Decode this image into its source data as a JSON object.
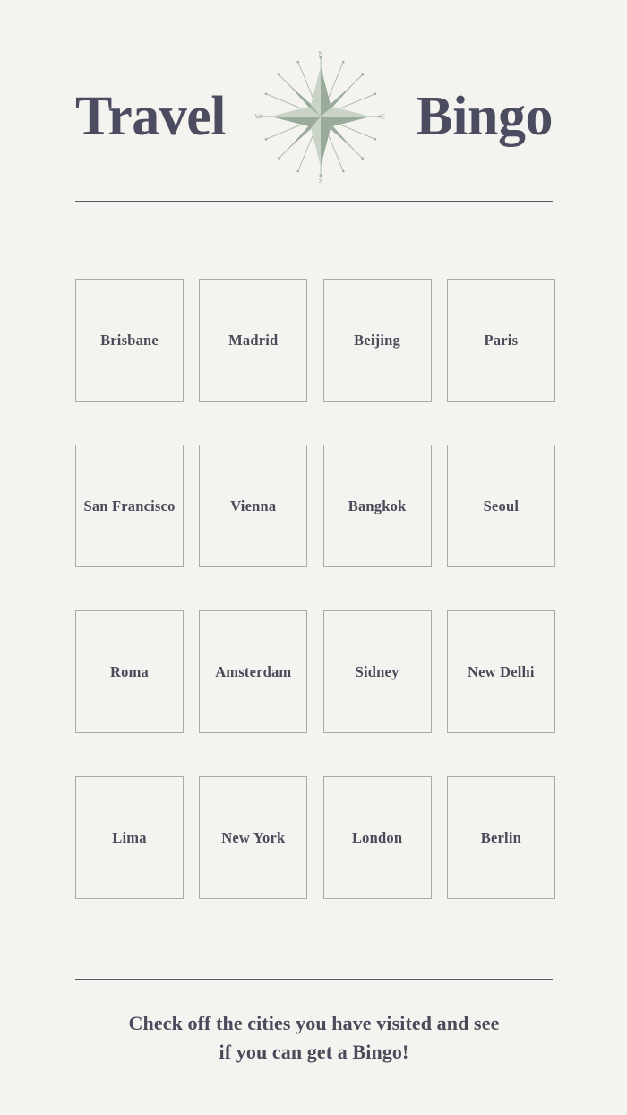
{
  "theme": {
    "background": "#f4f3ef",
    "title_color": "#4c4c61",
    "text_color": "#4a4a5a",
    "cell_border_color": "#a8aca5",
    "divider_color": "#5c5c68",
    "compass_color": "#9aab9c"
  },
  "header": {
    "title_left": "Travel",
    "title_right": "Bingo",
    "compass_icon": "compass-rose-icon",
    "compass_labels": {
      "north": "N",
      "east": "E",
      "south": "S",
      "west": "W"
    }
  },
  "grid": {
    "rows": 4,
    "columns": 4,
    "cells": [
      "Brisbane",
      "Madrid",
      "Beijing",
      "Paris",
      "San Francisco",
      "Vienna",
      "Bangkok",
      "Seoul",
      "Roma",
      "Amsterdam",
      "Sidney",
      "New Delhi",
      "Lima",
      "New York",
      "London",
      "Berlin"
    ]
  },
  "footer": {
    "line1": "Check off the cities you have visited and see",
    "line2": "if you can get a Bingo!"
  }
}
